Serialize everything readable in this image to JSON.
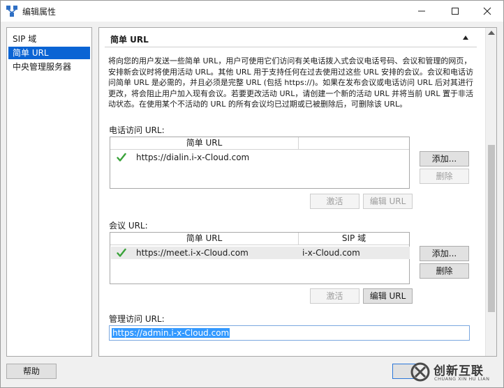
{
  "window": {
    "title": "编辑属性",
    "minimize_icon": "minimize-icon",
    "maximize_icon": "maximize-icon",
    "close_icon": "close-icon"
  },
  "nav": {
    "items": [
      {
        "label": "SIP 域",
        "selected": false
      },
      {
        "label": "简单 URL",
        "selected": true
      },
      {
        "label": "中央管理服务器",
        "selected": false
      }
    ]
  },
  "section": {
    "title": "简单 URL",
    "description": "将向您的用户发送一些简单 URL，用户可使用它们访问有关电话拨入式会议电话号码、会议和管理的网页，安排新会议时将使用活动 URL。其他 URL 用于支持任何在过去使用过这些 URL 安排的会议。会议和电话访问简单 URL 是必需的，并且必须是完整 URL (包括 https://)。如果在发布会议或电话访问 URL 后对其进行更改，将会阻止用户加入现有会议。若要更改活动 URL，请创建一个新的活动 URL 并将当前 URL 置于非活动状态。在使用某个不活动的 URL 的所有会议均已过期或已被删除后，可删除该 URL。"
  },
  "phone_access": {
    "label": "电话访问 URL:",
    "columns": [
      "简单 URL"
    ],
    "rows": [
      {
        "url": "https://dialin.i-x-Cloud.com",
        "active": true
      }
    ],
    "add_label": "添加...",
    "delete_label": "删除",
    "activate_label": "激活",
    "edit_label": "编辑 URL"
  },
  "meeting": {
    "label": "会议 URL:",
    "columns": [
      "简单 URL",
      "SIP 域"
    ],
    "rows": [
      {
        "url": "https://meet.i-x-Cloud.com",
        "sip_domain": "i-x-Cloud.com",
        "active": true
      }
    ],
    "add_label": "添加...",
    "delete_label": "删除",
    "activate_label": "激活",
    "edit_label": "编辑 URL"
  },
  "admin_access": {
    "label": "管理访问 URL:",
    "value": "https://admin.i-x-Cloud.com"
  },
  "footer": {
    "help_label": "帮助"
  },
  "watermark": {
    "name": "创新互联",
    "sub": "CHUANG XIN HU LIAN"
  },
  "colors": {
    "selection": "#0a64d4",
    "check": "#3aa33a",
    "focus_border": "#2b77d8"
  }
}
